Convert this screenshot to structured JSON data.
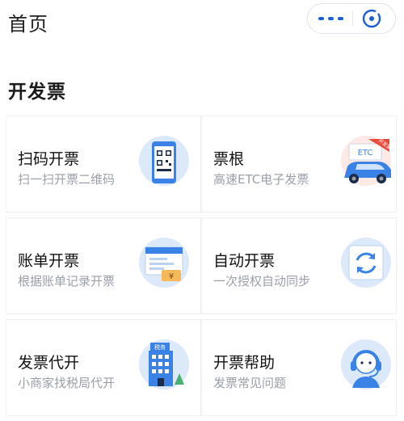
{
  "header": {
    "title": "首页"
  },
  "section": {
    "title": "开发票",
    "cards": [
      {
        "title": "扫码开票",
        "subtitle": "扫一扫开票二维码",
        "icon": "qr-phone-icon"
      },
      {
        "title": "票根",
        "subtitle": "高速ETC电子发票",
        "icon": "etc-car-icon",
        "icon_text": "ETC",
        "icon_badge": "开发票"
      },
      {
        "title": "账单开票",
        "subtitle": "根据账单记录开票",
        "icon": "bill-icon",
        "icon_text": "¥"
      },
      {
        "title": "自动开票",
        "subtitle": "一次授权自动同步",
        "icon": "auto-sync-icon"
      },
      {
        "title": "发票代开",
        "subtitle": "小商家找税局代开",
        "icon": "tax-office-icon",
        "icon_text": "税务"
      },
      {
        "title": "开票帮助",
        "subtitle": "发票常见问题",
        "icon": "customer-service-icon"
      }
    ]
  },
  "colors": {
    "accent": "#1c5ed6",
    "icon_light": "#dbe9fb",
    "icon_mid": "#5aa0ec",
    "subtitle": "#9aa0a8"
  }
}
